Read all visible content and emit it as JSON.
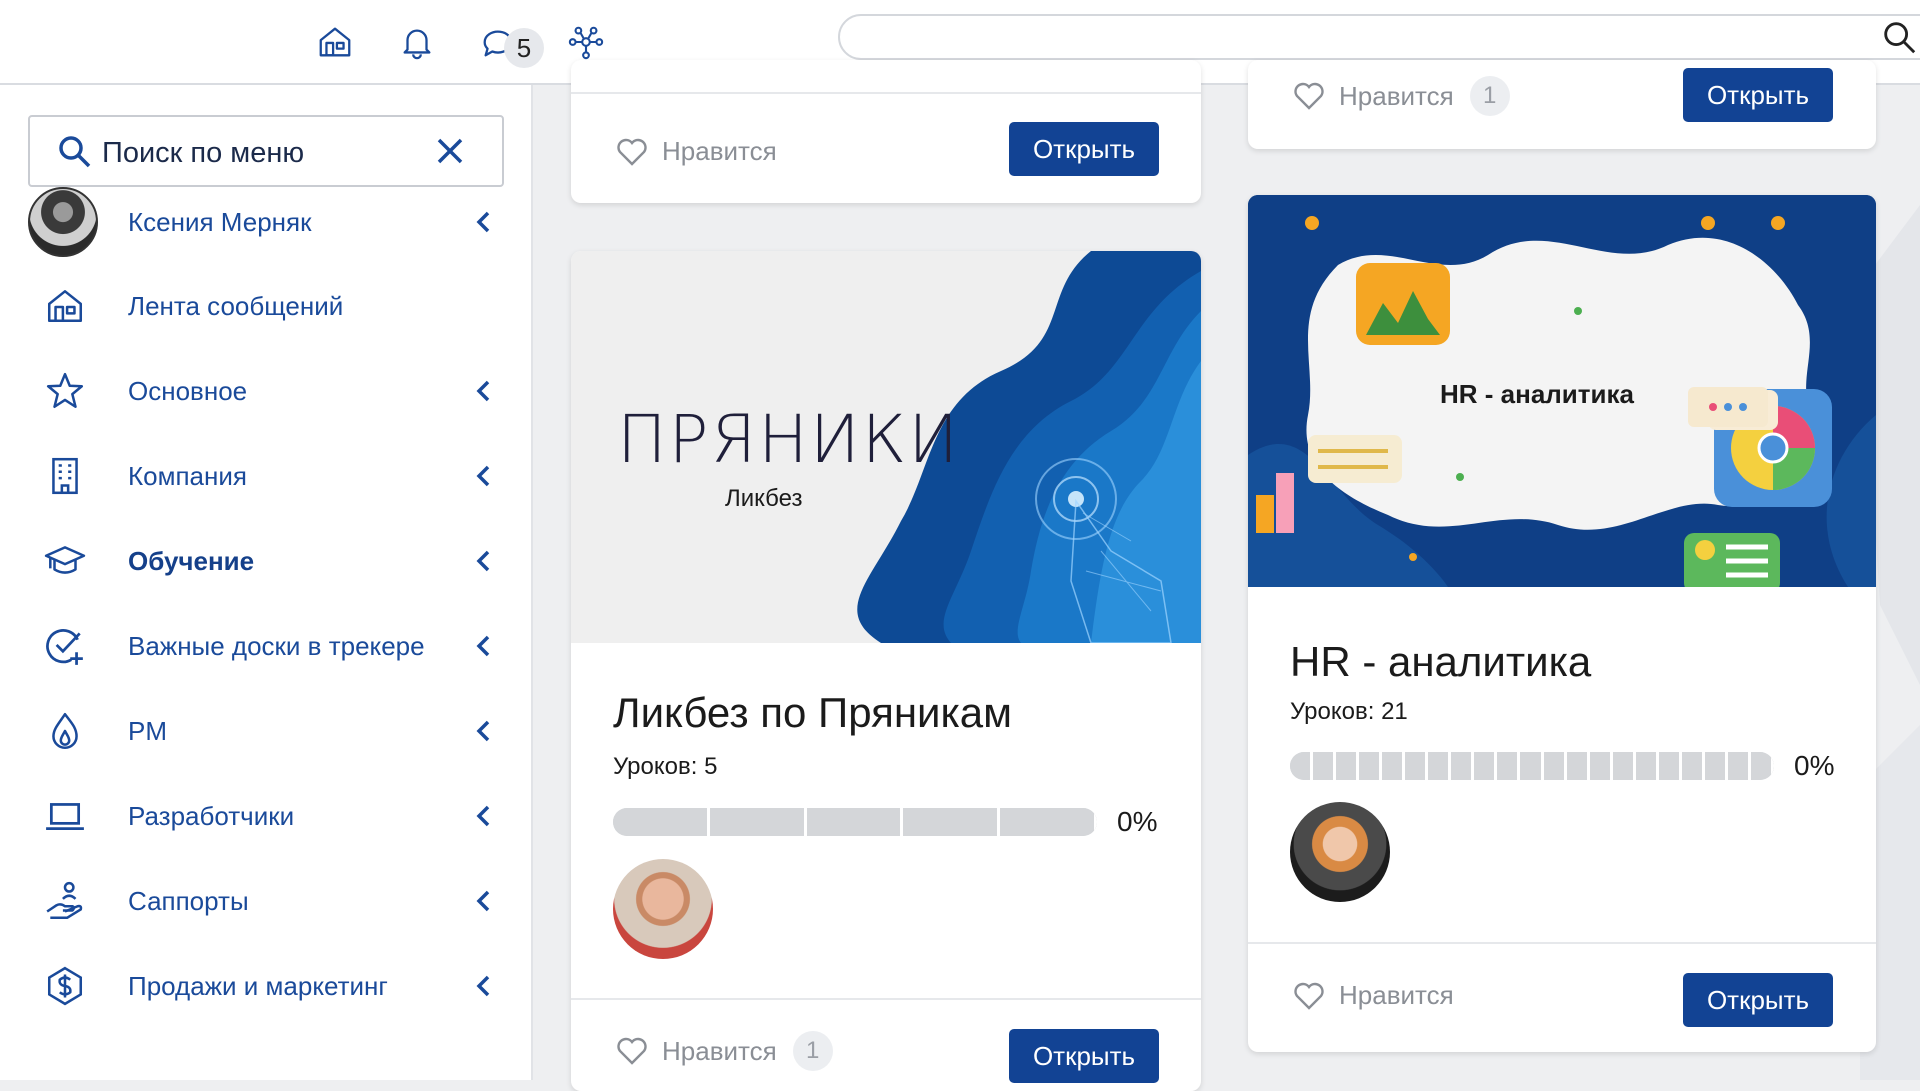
{
  "topbar": {
    "icons": [
      "home-icon",
      "bell-icon",
      "chat-icon",
      "network-icon"
    ],
    "messages_badge": "5",
    "search_placeholder": ""
  },
  "sidebar": {
    "search_placeholder": "Поиск по меню",
    "items": [
      {
        "label": "Ксения Мерняк",
        "icon": "user-avatar",
        "has_submenu": true,
        "active": false
      },
      {
        "label": "Лента сообщений",
        "icon": "home-icon",
        "has_submenu": false,
        "active": false
      },
      {
        "label": "Основное",
        "icon": "star-icon",
        "has_submenu": true,
        "active": false
      },
      {
        "label": "Компания",
        "icon": "building-icon",
        "has_submenu": true,
        "active": false
      },
      {
        "label": "Обучение",
        "icon": "graduation-cap-icon",
        "has_submenu": true,
        "active": true
      },
      {
        "label": "Важные доски в трекере",
        "icon": "check-plus-icon",
        "has_submenu": true,
        "active": false
      },
      {
        "label": "PM",
        "icon": "flame-icon",
        "has_submenu": true,
        "active": false
      },
      {
        "label": "Разработчики",
        "icon": "laptop-icon",
        "has_submenu": true,
        "active": false
      },
      {
        "label": "Саппорты",
        "icon": "support-hand-icon",
        "has_submenu": true,
        "active": false
      },
      {
        "label": "Продажи и маркетинг",
        "icon": "dollar-icon",
        "has_submenu": true,
        "active": false
      }
    ]
  },
  "cards": {
    "top_left": {
      "like_label": "Нравится",
      "open_label": "Открыть"
    },
    "top_right": {
      "like_label": "Нравится",
      "like_count": "1",
      "open_label": "Открыть"
    },
    "likbez": {
      "cover_logo": "ПРЯНИКИ",
      "cover_subtitle": "Ликбез",
      "title": "Ликбез по Пряникам",
      "lessons": "Уроков: 5",
      "progress_percent": "0%",
      "progress_value": 0,
      "segments": 5,
      "like_label": "Нравится",
      "like_count": "1",
      "open_label": "Открыть"
    },
    "hr": {
      "cover_title": "HR - аналитика",
      "title": "HR - аналитика",
      "lessons": "Уроков: 21",
      "progress_percent": "0%",
      "progress_value": 0,
      "segments": 21,
      "like_label": "Нравится",
      "open_label": "Открыть"
    }
  },
  "colors": {
    "brand_blue": "#124394",
    "nav_text": "#1a4a9a",
    "background": "#eeeff1"
  }
}
